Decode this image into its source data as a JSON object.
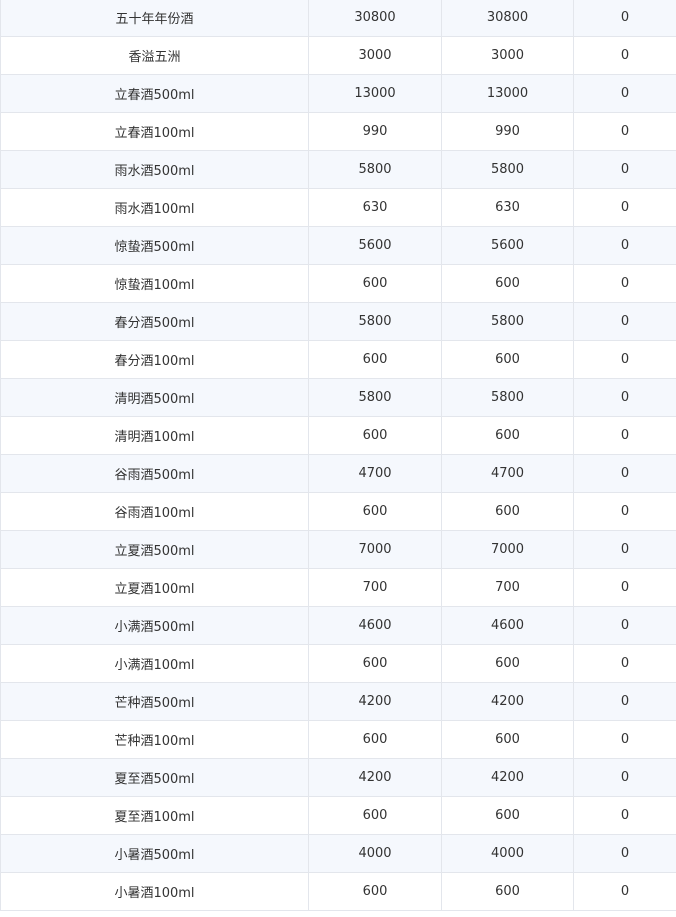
{
  "table": {
    "rows": [
      [
        "五十年年份酒",
        "30800",
        "30800",
        "0"
      ],
      [
        "香溢五洲",
        "3000",
        "3000",
        "0"
      ],
      [
        "立春酒500ml",
        "13000",
        "13000",
        "0"
      ],
      [
        "立春酒100ml",
        "990",
        "990",
        "0"
      ],
      [
        "雨水酒500ml",
        "5800",
        "5800",
        "0"
      ],
      [
        "雨水酒100ml",
        "630",
        "630",
        "0"
      ],
      [
        "惊蛰酒500ml",
        "5600",
        "5600",
        "0"
      ],
      [
        "惊蛰酒100ml",
        "600",
        "600",
        "0"
      ],
      [
        "春分酒500ml",
        "5800",
        "5800",
        "0"
      ],
      [
        "春分酒100ml",
        "600",
        "600",
        "0"
      ],
      [
        "清明酒500ml",
        "5800",
        "5800",
        "0"
      ],
      [
        "清明酒100ml",
        "600",
        "600",
        "0"
      ],
      [
        "谷雨酒500ml",
        "4700",
        "4700",
        "0"
      ],
      [
        "谷雨酒100ml",
        "600",
        "600",
        "0"
      ],
      [
        "立夏酒500ml",
        "7000",
        "7000",
        "0"
      ],
      [
        "立夏酒100ml",
        "700",
        "700",
        "0"
      ],
      [
        "小满酒500ml",
        "4600",
        "4600",
        "0"
      ],
      [
        "小满酒100ml",
        "600",
        "600",
        "0"
      ],
      [
        "芒种酒500ml",
        "4200",
        "4200",
        "0"
      ],
      [
        "芒种酒100ml",
        "600",
        "600",
        "0"
      ],
      [
        "夏至酒500ml",
        "4200",
        "4200",
        "0"
      ],
      [
        "夏至酒100ml",
        "600",
        "600",
        "0"
      ],
      [
        "小暑酒500ml",
        "4000",
        "4000",
        "0"
      ],
      [
        "小暑酒100ml",
        "600",
        "600",
        "0"
      ]
    ]
  }
}
